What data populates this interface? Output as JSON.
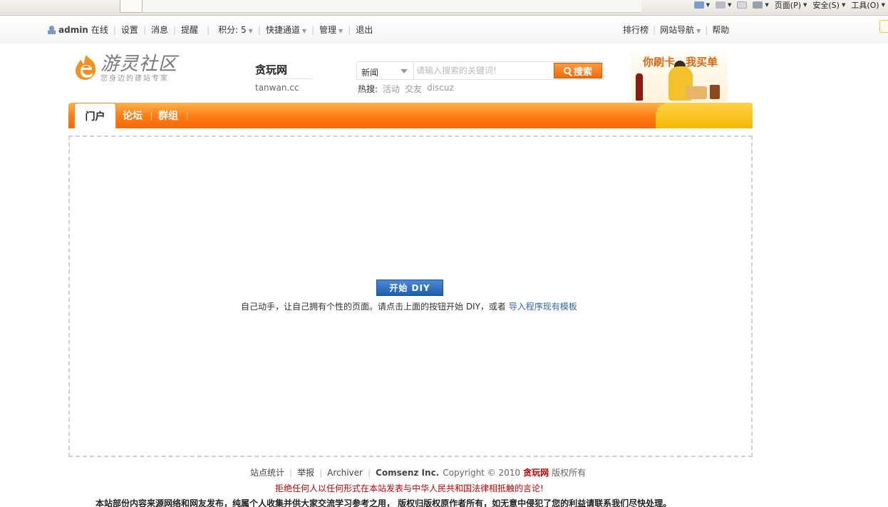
{
  "browser": {
    "tools": [
      {
        "name": "home",
        "label": ""
      },
      {
        "name": "rss",
        "label": ""
      },
      {
        "name": "mail",
        "label": ""
      },
      {
        "name": "print",
        "label": ""
      },
      {
        "name": "page",
        "label": "页面(P)"
      },
      {
        "name": "safety",
        "label": "安全(S)"
      },
      {
        "name": "tools",
        "label": "工具(O)"
      }
    ]
  },
  "topbar": {
    "username": "admin",
    "status": "在线",
    "links": [
      "设置",
      "消息",
      "提醒"
    ],
    "points_label": "积分: 5",
    "quick_label": "快捷通道",
    "manage_label": "管理",
    "logout_label": "退出",
    "right": {
      "rank": "排行榜",
      "site_nav": "网站导航",
      "help": "帮助"
    }
  },
  "header": {
    "logo_text": "游灵社区",
    "logo_sub": "您身边的建站专家",
    "site_name": "贪玩网",
    "site_url": "tanwan.cc",
    "search": {
      "type": "新闻",
      "placeholder": "请输入搜索的关键词!",
      "button": "搜索"
    },
    "hot": {
      "label": "热搜:",
      "terms": [
        "活动",
        "交友",
        "discuz"
      ]
    },
    "ad_text": "你刷卡，我买单"
  },
  "nav": {
    "active": "门户",
    "items": [
      "论坛",
      "群组"
    ]
  },
  "diy": {
    "button": "开始 DIY",
    "tip": "自己动手，让自己拥有个性的页面。请点击上面的按钮开始 DIY，或者",
    "tip_link": "导入程序现有模板"
  },
  "footer": {
    "links": [
      "站点统计",
      "举报",
      "Archiver"
    ],
    "brand": "Comsenz Inc.",
    "copyright": "Copyright © 2010",
    "site": "贪玩网",
    "rights": "版权所有",
    "warning": "拒绝任何人以任何形式在本站发表与中华人民共和国法律相抵触的言论!",
    "notice": "本站部份内容来源网络和网友发布，纯属个人收集并供大家交流学习参考之用，  版权归版权原作者所有，如无意中侵犯了您的利益请联系我们尽快处理。"
  },
  "colors": {
    "nav_orange": "#ff7a12",
    "nav_yellow": "#f5b800",
    "search_button": "#f06a10",
    "diy_button": "#1f5fb0",
    "warning_red": "#c40000"
  }
}
